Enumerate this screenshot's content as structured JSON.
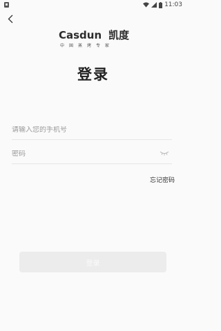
{
  "status_bar": {
    "time": "11:03"
  },
  "logo": {
    "brand_latin": "Casdun",
    "brand_cn": "凯度",
    "tagline": "中国蒸烤专家"
  },
  "page": {
    "title": "登录"
  },
  "form": {
    "phone_placeholder": "请输入您的手机号",
    "password_placeholder": "密码",
    "forgot_label": "忘记密码",
    "login_label": "登录"
  },
  "icons": {
    "back": "back-arrow-icon",
    "password_toggle": "eye-closed-icon",
    "wifi": "wifi-icon",
    "signal": "signal-icon",
    "battery": "battery-icon",
    "sim": "sim-card-icon"
  },
  "colors": {
    "background": "#fafafa",
    "button_disabled": "#ececec",
    "text_dark": "#222222",
    "placeholder": "#9a9a9a"
  }
}
